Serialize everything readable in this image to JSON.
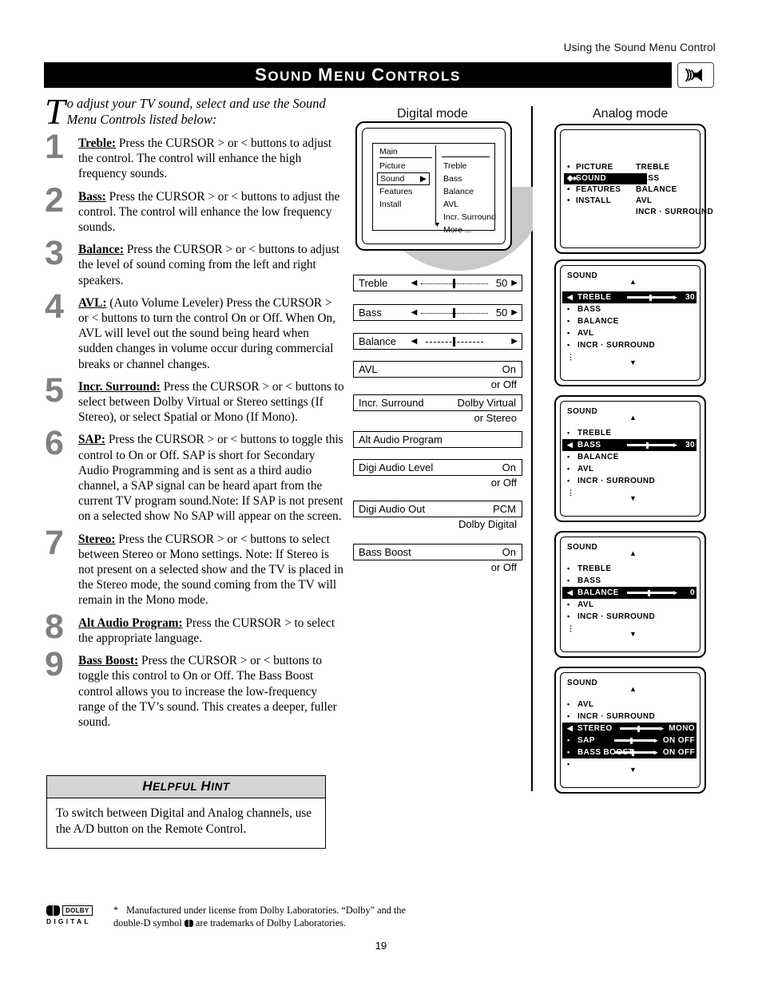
{
  "header": {
    "running_head": "Using the Sound Menu Control",
    "title_first": "S",
    "title_rest_1": "OUND ",
    "title_m": "M",
    "title_rest_2": "ENU ",
    "title_c": "C",
    "title_rest_3": "ONTROLS",
    "title_full": "Sound Menu Controls",
    "speaker_icon": "speaker-waves-icon"
  },
  "intro": {
    "dropcap": "T",
    "text": "o adjust your TV sound, select and use the Sound Menu Controls listed below:"
  },
  "steps": [
    {
      "num": "1",
      "term": "Treble:",
      "text": " Press the CURSOR > or < buttons to adjust the control. The control will enhance the high frequency sounds."
    },
    {
      "num": "2",
      "term": "Bass:",
      "text": " Press the CURSOR > or < buttons to adjust the control. The control will enhance the low frequency sounds."
    },
    {
      "num": "3",
      "term": "Balance:",
      "text": " Press the CURSOR > or < buttons to adjust the level of sound coming from the left and right speakers."
    },
    {
      "num": "4",
      "term": "AVL:",
      "text": "  (Auto Volume Leveler) Press the CURSOR > or < buttons to turn the control On or Off. When On, AVL will level out the sound being heard when sudden changes in volume occur during commercial breaks or channel changes."
    },
    {
      "num": "5",
      "term": "Incr. Surround:",
      "text": " Press the CURSOR > or < buttons to select between Dolby Virtual or Stereo settings (If Stereo), or select Spatial or Mono (If Mono)."
    },
    {
      "num": "6",
      "term": "SAP:",
      "text": " Press the CURSOR > or < buttons to toggle this control to On or Off.  SAP is short for Secondary Audio Programming and is sent as a third audio channel, a SAP signal can be heard apart from the current TV program sound.Note: If SAP is not present on a selected show No SAP will appear on the screen."
    },
    {
      "num": "7",
      "term": "Stereo:",
      "text": " Press the CURSOR > or < buttons to select between Stereo or Mono settings. Note: If Stereo is not present on a selected show and the TV is placed in the Stereo mode, the sound coming from the TV will remain in the Mono mode."
    },
    {
      "num": "8",
      "term": "Alt Audio Program:",
      "text": " Press the CURSOR > to select the appropriate language."
    },
    {
      "num": "9",
      "term": "Bass Boost:",
      "text": " Press the CURSOR > or < buttons to toggle this control to On or Off. The Bass Boost control  allows you to increase the low-frequency range of the TV’s sound. This creates a deeper, fuller sound."
    }
  ],
  "hint": {
    "head_h1": "H",
    "head_rest1": "ELPFUL ",
    "head_h2": "H",
    "head_rest2": "INT",
    "head_full": "Helpful Hint",
    "body": "To switch between Digital and Analog channels, use the A/D button on the Remote Control."
  },
  "digital": {
    "heading": "Digital mode",
    "menu": {
      "main_label": "Main",
      "left_items": [
        "Picture",
        "Sound",
        "Features",
        "Install"
      ],
      "selected_left": "Sound",
      "right_items": [
        "Treble",
        "Bass",
        "Balance",
        "AVL",
        "Incr. Surround",
        "More ..."
      ]
    },
    "bars": [
      {
        "label": "Treble",
        "type": "slider",
        "value": "50",
        "fill": 0.5,
        "style": "dotted"
      },
      {
        "label": "Bass",
        "type": "slider",
        "value": "50",
        "fill": 0.5,
        "style": "dotted"
      },
      {
        "label": "Balance",
        "type": "slider",
        "value": "",
        "fill": 0.5,
        "style": "dashed"
      },
      {
        "label": "AVL",
        "type": "value",
        "value": "On",
        "note": "or Off"
      },
      {
        "label": "Incr. Surround",
        "type": "value",
        "value": "Dolby Virtual",
        "note": "or Stereo"
      },
      {
        "label": "Alt Audio Program",
        "type": "value",
        "value": "",
        "note": ""
      },
      {
        "label": "Digi Audio Level",
        "type": "value",
        "value": "On",
        "note": "or Off"
      },
      {
        "label": "Digi Audio Out",
        "type": "value",
        "value": "PCM",
        "note": "Dolby Digital"
      },
      {
        "label": "Bass Boost",
        "type": "value",
        "value": "On",
        "note": "or Off"
      }
    ]
  },
  "analog": {
    "heading": "Analog mode",
    "panels": [
      {
        "id": "main",
        "title": "",
        "left": [
          "PICTURE",
          "SOUND",
          "FEATURES",
          "INSTALL"
        ],
        "right": [
          "TREBLE",
          "BASS",
          "BALANCE",
          "AVL",
          "INCR · SURROUND"
        ],
        "highlight": "SOUND"
      },
      {
        "id": "treble",
        "title": "SOUND",
        "rows": [
          {
            "name": "TREBLE",
            "hl": true,
            "bar": true,
            "knob": 0.5,
            "value": "30"
          },
          {
            "name": "BASS",
            "hl": false
          },
          {
            "name": "BALANCE",
            "hl": false
          },
          {
            "name": "AVL",
            "hl": false
          },
          {
            "name": "INCR · SURROUND",
            "hl": false
          }
        ]
      },
      {
        "id": "bass",
        "title": "SOUND",
        "rows": [
          {
            "name": "TREBLE",
            "hl": false
          },
          {
            "name": "BASS",
            "hl": true,
            "bar": true,
            "knob": 0.42,
            "value": "30"
          },
          {
            "name": "BALANCE",
            "hl": false
          },
          {
            "name": "AVL",
            "hl": false
          },
          {
            "name": "INCR · SURROUND",
            "hl": false
          }
        ]
      },
      {
        "id": "balance",
        "title": "SOUND",
        "rows": [
          {
            "name": "TREBLE",
            "hl": false
          },
          {
            "name": "BASS",
            "hl": false
          },
          {
            "name": "BALANCE",
            "hl": true,
            "bar": true,
            "knob": 0.45,
            "value": "0"
          },
          {
            "name": "AVL",
            "hl": false
          },
          {
            "name": "INCR · SURROUND",
            "hl": false
          }
        ]
      },
      {
        "id": "stereo",
        "title": "SOUND",
        "rows": [
          {
            "name": "AVL",
            "hl": false
          },
          {
            "name": "INCR · SURROUND",
            "hl": false
          },
          {
            "name": "STEREO",
            "hl": true,
            "bar": true,
            "knob": 0.45,
            "opt": "MONO"
          },
          {
            "name": "SAP",
            "hl": true,
            "bar": true,
            "knob": 0.42,
            "opt": "ON OFF"
          },
          {
            "name": "BASS BOOST",
            "hl": true,
            "bar": true,
            "knob": 0.45,
            "opt": "ON OFF"
          }
        ]
      }
    ]
  },
  "footer": {
    "dolby_word": "DOLBY",
    "dolby_sub": "DIGITAL",
    "star": "*",
    "note_part1": "Manufactured under license from Dolby Laboratories. “Dolby” and the double-D symbol ",
    "note_part2": " are trademarks of Dolby Laboratories.",
    "page_number": "19"
  }
}
